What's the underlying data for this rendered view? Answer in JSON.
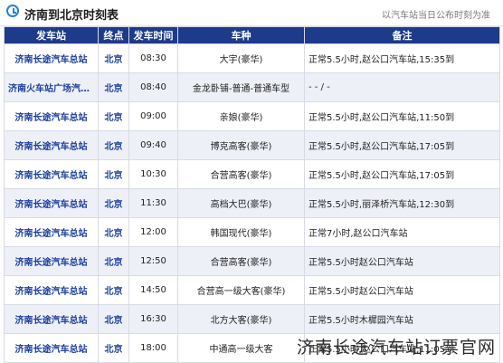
{
  "header": {
    "title": "济南到北京时刻表",
    "note": "以汽车站当日公布时刻为准"
  },
  "table": {
    "columns": [
      "发车站",
      "终点",
      "发车时间",
      "车种",
      "备注"
    ],
    "rows": [
      {
        "station": "济南长途汽车总站",
        "dest": "北京",
        "time": "08:30",
        "type": "大宇(豪华)",
        "remark": "正常5.5小时,赵公口汽车站,15:35到"
      },
      {
        "station": "济南火车站广场汽车站",
        "dest": "北京",
        "time": "08:40",
        "type": "金龙卧铺-普通-普通车型",
        "remark": "- - / -"
      },
      {
        "station": "济南长途汽车总站",
        "dest": "北京",
        "time": "09:00",
        "type": "亲娘(豪华)",
        "remark": "正常5.5小时,赵公口汽车站,11:50到"
      },
      {
        "station": "济南长途汽车总站",
        "dest": "北京",
        "time": "09:40",
        "type": "博克高客(豪华)",
        "remark": "正常5.5小时,赵公口汽车站,17:05到"
      },
      {
        "station": "济南长途汽车总站",
        "dest": "北京",
        "time": "10:30",
        "type": "合营高客(豪华)",
        "remark": "正常5.5小时,赵公口汽车站,17:05到"
      },
      {
        "station": "济南长途汽车总站",
        "dest": "北京",
        "time": "11:30",
        "type": "高档大巴(豪华)",
        "remark": "正常5.5小时,丽泽桥汽车站,12:30到"
      },
      {
        "station": "济南长途汽车总站",
        "dest": "北京",
        "time": "12:00",
        "type": "韩国现代(豪华)",
        "remark": "正常7小时,赵公口汽车站"
      },
      {
        "station": "济南长途汽车总站",
        "dest": "北京",
        "time": "12:50",
        "type": "合营高客(豪华)",
        "remark": "正常5.5小时赵公口汽车站"
      },
      {
        "station": "济南长途汽车总站",
        "dest": "北京",
        "time": "14:50",
        "type": "合营高一级大客(豪华)",
        "remark": "正常5.5小时赵公口汽车站"
      },
      {
        "station": "济南长途汽车总站",
        "dest": "北京",
        "time": "16:30",
        "type": "北方大客(豪华)",
        "remark": "正常5.5小时木樨园汽车站"
      },
      {
        "station": "济南长途汽车总站",
        "dest": "北京",
        "time": "18:00",
        "type": "中通高一级大客",
        "remark": "正常5.5小时,赵公口汽车站,11:05到"
      }
    ]
  },
  "watermark": "济南长途汽车站订票官网"
}
